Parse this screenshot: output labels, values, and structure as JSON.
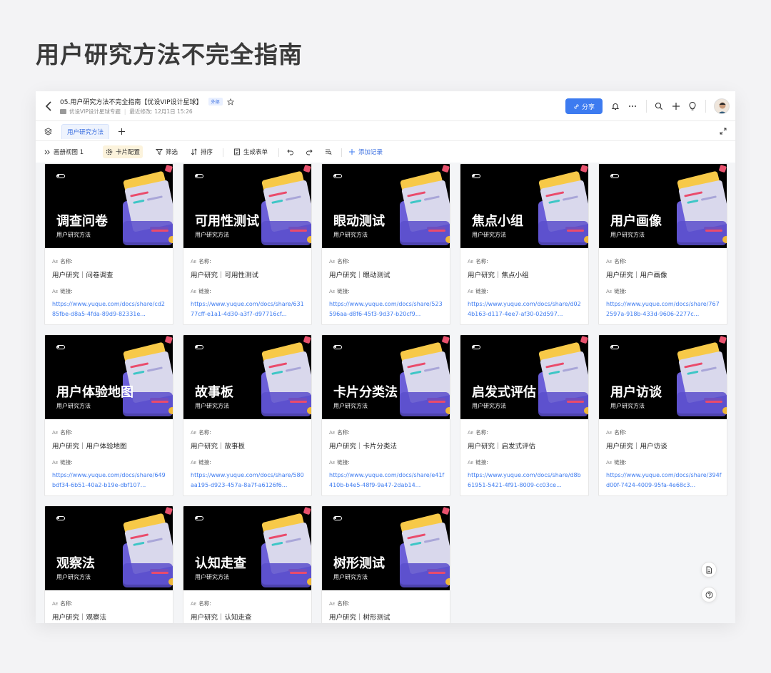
{
  "page_title": "用户研究方法不完全指南",
  "header": {
    "doc_title": "05.用户研究方法不完全指南【优设VIP设计星球】",
    "ext_badge": "外部",
    "folder": "优设VIP设计星球专题",
    "last_modified": "最近修改: 12月1日 15:26",
    "share_label": "分享"
  },
  "tabs": [
    {
      "label": "用户研究方法"
    }
  ],
  "toolbar": {
    "view_label": "画册视图 1",
    "card_config": "卡片配置",
    "filter": "筛选",
    "sort": "排序",
    "generate_form": "生成表单",
    "add_record": "添加记录"
  },
  "field_labels": {
    "name": "名称:",
    "link": "链接:"
  },
  "cards": [
    {
      "title": "调查问卷",
      "subtitle": "用户研究方法",
      "name": "用户研究｜问卷调查",
      "link": "https://www.yuque.com/docs/share/cd285fbe-d8a5-4fda-89d9-82331e..."
    },
    {
      "title": "可用性测试",
      "subtitle": "用户研究方法",
      "name": "用户研究｜可用性测试",
      "link": "https://www.yuque.com/docs/share/63177cff-e1a1-4d30-a3f7-d97716cf..."
    },
    {
      "title": "眼动测试",
      "subtitle": "用户研究方法",
      "name": "用户研究｜眼动测试",
      "link": "https://www.yuque.com/docs/share/523596aa-d8f6-45f3-9d37-b20cf9..."
    },
    {
      "title": "焦点小组",
      "subtitle": "用户研究方法",
      "name": "用户研究｜焦点小组",
      "link": "https://www.yuque.com/docs/share/d024b163-d117-4ee7-af30-02d597..."
    },
    {
      "title": "用户画像",
      "subtitle": "用户研究方法",
      "name": "用户研究｜用户画像",
      "link": "https://www.yuque.com/docs/share/7672597a-918b-433d-9606-2277c..."
    },
    {
      "title": "用户体验地图",
      "subtitle": "用户研究方法",
      "name": "用户研究｜用户体验地图",
      "link": "https://www.yuque.com/docs/share/649bdf34-6b51-40a2-b19e-dbf107..."
    },
    {
      "title": "故事板",
      "subtitle": "用户研究方法",
      "name": "用户研究｜故事板",
      "link": "https://www.yuque.com/docs/share/580aa195-d923-457a-8a7f-a6126f6..."
    },
    {
      "title": "卡片分类法",
      "subtitle": "用户研究方法",
      "name": "用户研究｜卡片分类法",
      "link": "https://www.yuque.com/docs/share/e41f410b-b4e5-48f9-9a47-2dab14..."
    },
    {
      "title": "启发式评估",
      "subtitle": "用户研究方法",
      "name": "用户研究｜启发式评估",
      "link": "https://www.yuque.com/docs/share/d8b61951-5421-4f91-8009-cc03ce..."
    },
    {
      "title": "用户访谈",
      "subtitle": "用户研究方法",
      "name": "用户研究｜用户访谈",
      "link": "https://www.yuque.com/docs/share/394fd00f-7424-4009-95fa-4e68c3..."
    },
    {
      "title": "观察法",
      "subtitle": "用户研究方法",
      "name": "用户研究｜观察法",
      "link": ""
    },
    {
      "title": "认知走查",
      "subtitle": "用户研究方法",
      "name": "用户研究｜认知走查",
      "link": ""
    },
    {
      "title": "树形测试",
      "subtitle": "用户研究方法",
      "name": "用户研究｜树形测试",
      "link": ""
    }
  ],
  "colors": {
    "accent": "#3d7bf0",
    "cover_bg": "#000000",
    "card_config_bg": "#fcf3dc"
  },
  "icons": [
    "back-icon",
    "star-icon",
    "folder-icon",
    "link-icon",
    "bell-icon",
    "more-icon",
    "search-icon",
    "plus-icon",
    "bulb-icon",
    "layers-icon",
    "add-tab-icon",
    "expand-icon",
    "chevron-double-right-icon",
    "gear-icon",
    "filter-icon",
    "sort-icon",
    "form-icon",
    "undo-icon",
    "redo-icon",
    "find-icon",
    "doc-icon",
    "help-icon"
  ]
}
